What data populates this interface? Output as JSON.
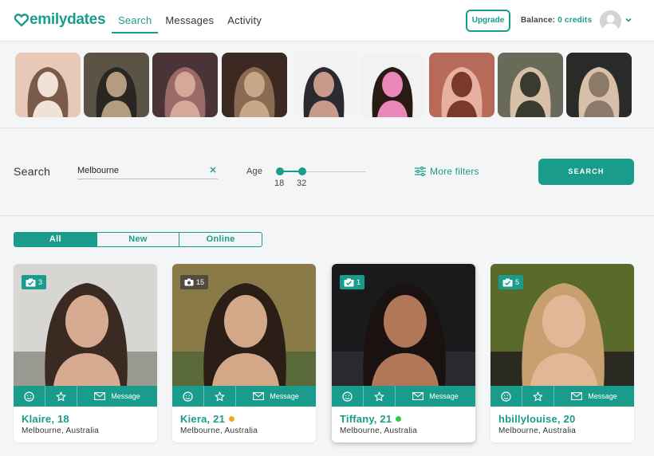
{
  "app": {
    "logo_text": "emilydates",
    "brand_color": "#1a9c8c"
  },
  "nav": {
    "items": [
      {
        "label": "Search",
        "active": true
      },
      {
        "label": "Messages",
        "active": false
      },
      {
        "label": "Activity",
        "active": false
      }
    ]
  },
  "header": {
    "upgrade_label": "Upgrade",
    "balance_label": "Balance:",
    "balance_value": "0 credits"
  },
  "strip": {
    "photos": [
      {
        "icon": "profile-photo",
        "palette": [
          "#e8c9b8",
          "#7a5a48",
          "#f1e2d8"
        ]
      },
      {
        "icon": "profile-photo",
        "palette": [
          "#5b5446",
          "#2a2622",
          "#b39c80"
        ]
      },
      {
        "icon": "profile-photo",
        "palette": [
          "#4a3438",
          "#9a6a68",
          "#d6a89a"
        ]
      },
      {
        "icon": "profile-photo",
        "palette": [
          "#3c2a22",
          "#8a6a52",
          "#c8a888"
        ]
      },
      {
        "icon": "profile-photo",
        "palette": [
          "#f3f3f3",
          "#2a2a30",
          "#c89a8a"
        ]
      },
      {
        "icon": "profile-photo",
        "palette": [
          "#f2f2f2",
          "#2a1a14",
          "#e888b8"
        ]
      },
      {
        "icon": "profile-photo",
        "palette": [
          "#b86a58",
          "#e8b0a0",
          "#7a3a2a"
        ]
      },
      {
        "icon": "profile-photo",
        "palette": [
          "#6a6a5a",
          "#d8c0a8",
          "#3a3a30"
        ]
      },
      {
        "icon": "profile-photo",
        "palette": [
          "#2a2a28",
          "#d8bfa8",
          "#8a7a6a"
        ]
      }
    ]
  },
  "search": {
    "label": "Search",
    "location_value": "Melbourne",
    "age_label": "Age",
    "age_min": "18",
    "age_max": "32",
    "more_filters_label": "More filters",
    "search_button_label": "SEARCH"
  },
  "tabs": [
    {
      "label": "All",
      "active": true
    },
    {
      "label": "New",
      "active": false
    },
    {
      "label": "Online",
      "active": false
    }
  ],
  "cards": [
    {
      "name": "Klaire, 18",
      "location": "Melbourne, Australia",
      "photo_count": "3",
      "badge_icon": "verified-camera-icon",
      "badge_style": "teal",
      "status": "none",
      "status_color": "",
      "message_label": "Message",
      "highlight": false
    },
    {
      "name": "Kiera, 21",
      "location": "Melbourne, Australia",
      "photo_count": "15",
      "badge_icon": "camera-icon",
      "badge_style": "dark",
      "status": "away",
      "status_color": "#f5a623",
      "message_label": "Message",
      "highlight": false
    },
    {
      "name": "Tiffany, 21",
      "location": "Melbourne, Australia",
      "photo_count": "1",
      "badge_icon": "verified-camera-icon",
      "badge_style": "teal",
      "status": "online",
      "status_color": "#2ecc40",
      "message_label": "Message",
      "highlight": true
    },
    {
      "name": "hbillylouise, 20",
      "location": "Melbourne, Australia",
      "photo_count": "5",
      "badge_icon": "verified-camera-icon",
      "badge_style": "teal",
      "status": "none",
      "status_color": "",
      "message_label": "Message",
      "highlight": false
    }
  ]
}
